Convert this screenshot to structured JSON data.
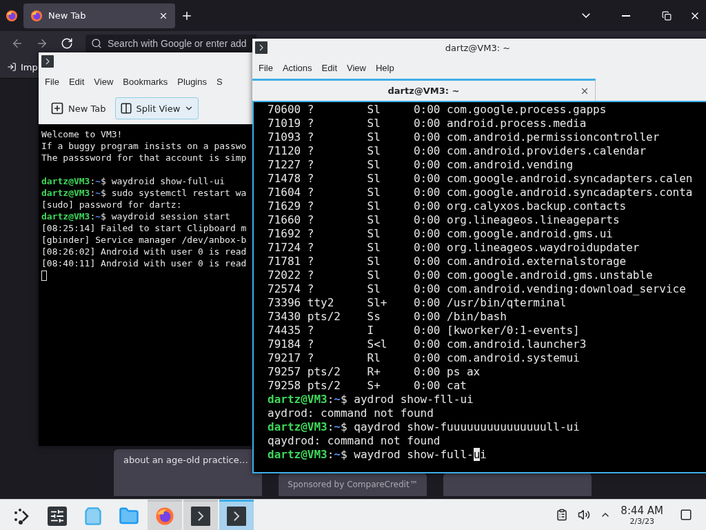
{
  "browser": {
    "tabs": [
      {
        "label": "New Tab",
        "selected": true
      }
    ],
    "search": {
      "placeholder": "Search with Google or enter add"
    },
    "bookmarks": [
      "Imp"
    ],
    "cards": [
      {
        "kind": "story",
        "text": "about an age-old practice…"
      },
      {
        "kind": "sponsored",
        "text": "Sponsored by CompareCredit™"
      },
      {
        "kind": "blank"
      }
    ]
  },
  "konsole": {
    "menu": [
      "File",
      "Edit",
      "View",
      "Bookmarks",
      "Plugins",
      "S"
    ],
    "toolbar": {
      "new_tab": "New Tab",
      "split_view": "Split View"
    },
    "lines": [
      {
        "kind": "text",
        "text": "Welcome to VM3!"
      },
      {
        "kind": "text",
        "text": "If a buggy program insists on a passwo"
      },
      {
        "kind": "text",
        "text": "The passsword for that account is simp"
      },
      {
        "kind": "blank"
      },
      {
        "kind": "prompt",
        "user": "dartz@VM3",
        "colon": ":",
        "path": "~",
        "dollar": "$",
        "command": " waydroid show-full-ui"
      },
      {
        "kind": "prompt",
        "user": "dartz@VM3",
        "colon": ":",
        "path": "~",
        "dollar": "$",
        "command": " sudo systemctl restart wa"
      },
      {
        "kind": "text",
        "text": "[sudo] password for dartz:"
      },
      {
        "kind": "prompt",
        "user": "dartz@VM3",
        "colon": ":",
        "path": "~",
        "dollar": "$",
        "command": " waydroid session start"
      },
      {
        "kind": "text",
        "text": "[08:25:14] Failed to start Clipboard m"
      },
      {
        "kind": "text",
        "text": "[gbinder] Service manager /dev/anbox-b"
      },
      {
        "kind": "text",
        "text": "[08:26:02] Android with user 0 is read"
      },
      {
        "kind": "text",
        "text": "[08:40:11] Android with user 0 is read"
      },
      {
        "kind": "cursor"
      }
    ]
  },
  "qterminal": {
    "title": "dartz@VM3: ~",
    "menu": [
      "File",
      "Actions",
      "Edit",
      "View",
      "Help"
    ],
    "tabs": [
      {
        "label": "dartz@VM3: ~",
        "selected": true
      }
    ],
    "lines": [
      {
        "kind": "text",
        "text": "70600 ?        Sl     0:00 com.google.process.gapps"
      },
      {
        "kind": "text",
        "text": "71019 ?        Sl     0:00 android.process.media"
      },
      {
        "kind": "text",
        "text": "71093 ?        Sl     0:00 com.android.permissioncontroller"
      },
      {
        "kind": "text",
        "text": "71120 ?        Sl     0:00 com.android.providers.calendar"
      },
      {
        "kind": "text",
        "text": "71227 ?        Sl     0:00 com.android.vending"
      },
      {
        "kind": "text",
        "text": "71478 ?        Sl     0:00 com.google.android.syncadapters.calen"
      },
      {
        "kind": "text",
        "text": "71604 ?        Sl     0:00 com.google.android.syncadapters.conta"
      },
      {
        "kind": "text",
        "text": "71629 ?        Sl     0:00 org.calyxos.backup.contacts"
      },
      {
        "kind": "text",
        "text": "71660 ?        Sl     0:00 org.lineageos.lineageparts"
      },
      {
        "kind": "text",
        "text": "71692 ?        Sl     0:00 com.google.android.gms.ui"
      },
      {
        "kind": "text",
        "text": "71724 ?        Sl     0:00 org.lineageos.waydroidupdater"
      },
      {
        "kind": "text",
        "text": "71781 ?        Sl     0:00 com.android.externalstorage"
      },
      {
        "kind": "text",
        "text": "72022 ?        Sl     0:00 com.google.android.gms.unstable"
      },
      {
        "kind": "text",
        "text": "72574 ?        Sl     0:00 com.android.vending:download_service"
      },
      {
        "kind": "text",
        "text": "73396 tty2     Sl+    0:00 /usr/bin/qterminal"
      },
      {
        "kind": "text",
        "text": "73430 pts/2    Ss     0:00 /bin/bash"
      },
      {
        "kind": "text",
        "text": "74435 ?        I      0:00 [kworker/0:1-events]"
      },
      {
        "kind": "text",
        "text": "79184 ?        S<l    0:00 com.android.launcher3"
      },
      {
        "kind": "text",
        "text": "79217 ?        Rl     0:00 com.android.systemui"
      },
      {
        "kind": "text",
        "text": "79257 pts/2    R+     0:00 ps ax"
      },
      {
        "kind": "text",
        "text": "79258 pts/2    S+     0:00 cat"
      },
      {
        "kind": "prompt",
        "user": "dartz@VM3",
        "colon": ":",
        "path": "~",
        "dollar": "$",
        "command": " aydrod show-fll-ui"
      },
      {
        "kind": "text",
        "text": "aydrod: command not found"
      },
      {
        "kind": "prompt",
        "user": "dartz@VM3",
        "colon": ":",
        "path": "~",
        "dollar": "$",
        "command": " qaydrod show-fuuuuuuuuuuuuuuull-ui"
      },
      {
        "kind": "text",
        "text": "qaydrod: command not found"
      },
      {
        "kind": "prompt",
        "user": "dartz@VM3",
        "colon": ":",
        "path": "~",
        "dollar": "$",
        "command": " waydrod show-full-",
        "cursor_char": "u",
        "after": "i"
      }
    ]
  },
  "taskbar": {
    "items": [
      {
        "kind": "launcher",
        "open": false,
        "selected": false
      },
      {
        "kind": "settings",
        "open": false,
        "selected": false
      },
      {
        "kind": "store",
        "open": false,
        "selected": false
      },
      {
        "kind": "files",
        "open": false,
        "selected": false
      },
      {
        "kind": "browser",
        "open": true,
        "selected": false
      },
      {
        "kind": "terminal",
        "open": true,
        "selected": false
      },
      {
        "kind": "terminal",
        "open": true,
        "selected": true
      }
    ],
    "time": "8:44 AM",
    "date": "2/3/23"
  }
}
